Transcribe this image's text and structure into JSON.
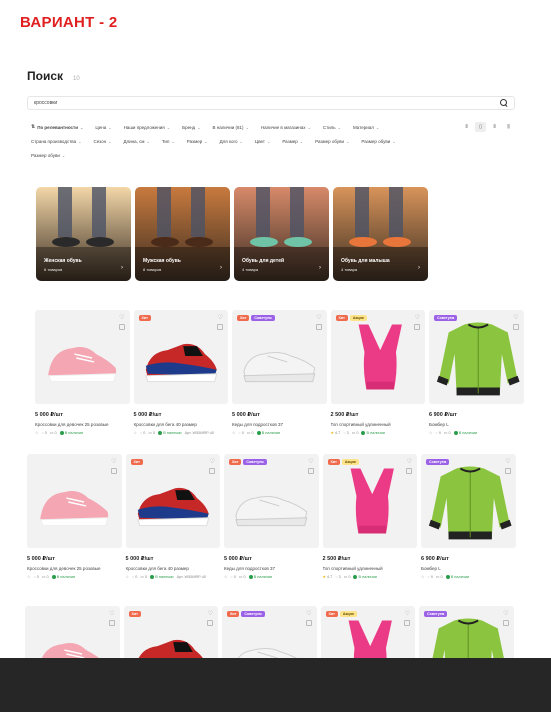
{
  "variant_label": "ВАРИАНТ - 2",
  "page": {
    "title": "Поиск",
    "count": "10"
  },
  "search": {
    "value": "кроссовки"
  },
  "filters": [
    {
      "label": "По релевантности",
      "sort": true
    },
    {
      "label": "Цена"
    },
    {
      "label": "Наши предложения"
    },
    {
      "label": "Бренд"
    },
    {
      "label": "В наличии (81)"
    },
    {
      "label": "Наличие в магазинах"
    },
    {
      "label": "Стиль"
    },
    {
      "label": "Материал"
    },
    {
      "label": "Страна производства"
    },
    {
      "label": "Сезон"
    },
    {
      "label": "Длина, см"
    },
    {
      "label": "Тип"
    },
    {
      "label": "Размер"
    },
    {
      "label": "Для кого"
    },
    {
      "label": "Цвет"
    },
    {
      "label": "Размер"
    },
    {
      "label": "Размер обуви"
    },
    {
      "label": "Размер обуви"
    },
    {
      "label": "Размер обуви"
    }
  ],
  "view_buttons": [
    "⫴",
    "▯",
    "⫴",
    "⫼"
  ],
  "categories": [
    {
      "label": "Женская обувь",
      "count": "6 товаров",
      "palette": [
        "#f3d7a8",
        "#2a2a2a"
      ]
    },
    {
      "label": "Мужская обувь",
      "count": "8 товаров",
      "palette": [
        "#c97a3e",
        "#4a2a18"
      ]
    },
    {
      "label": "Обувь для детей",
      "count": "4 товара",
      "palette": [
        "#d88a6a",
        "#6fc4a8"
      ]
    },
    {
      "label": "Обувь для малыша",
      "count": "4 товара",
      "palette": [
        "#d8945a",
        "#e8763a"
      ]
    }
  ],
  "products": [
    {
      "price": "5 000 ₽/шт",
      "name": "Кроссовки для девочек 25 розовые",
      "rating": "",
      "views": "0",
      "reviews": "0",
      "stock": "В наличии",
      "art": "",
      "badges": [],
      "kind": "pink-shoe"
    },
    {
      "price": "5 000 ₽/шт",
      "name": "Кроссовки для бега 40 размер",
      "rating": "",
      "views": "0",
      "reviews": "0",
      "stock": "В наличии",
      "art": "Арт. W55MRP-40",
      "badges": [
        "hit"
      ],
      "kind": "runner"
    },
    {
      "price": "5 000 ₽/шт",
      "name": "Кеды для подростков 37",
      "rating": "",
      "views": "0",
      "reviews": "0",
      "stock": "В наличии",
      "art": "",
      "badges": [
        "hit",
        "new"
      ],
      "kind": "white-shoe"
    },
    {
      "price": "2 500 ₽/шт",
      "name": "Топ спортивный удлиненный",
      "rating": "4.7",
      "views": "3",
      "reviews": "0",
      "stock": "В наличии",
      "art": "",
      "badges": [
        "hit",
        "promo"
      ],
      "kind": "top"
    },
    {
      "price": "6 900 ₽/шт",
      "name": "Бомбер L",
      "rating": "",
      "views": "9",
      "reviews": "0",
      "stock": "В наличии",
      "art": "",
      "badges": [
        "new"
      ],
      "kind": "bomber"
    }
  ],
  "badge_labels": {
    "hit": "Хит",
    "new": "Советуем",
    "promo": "Акция"
  }
}
